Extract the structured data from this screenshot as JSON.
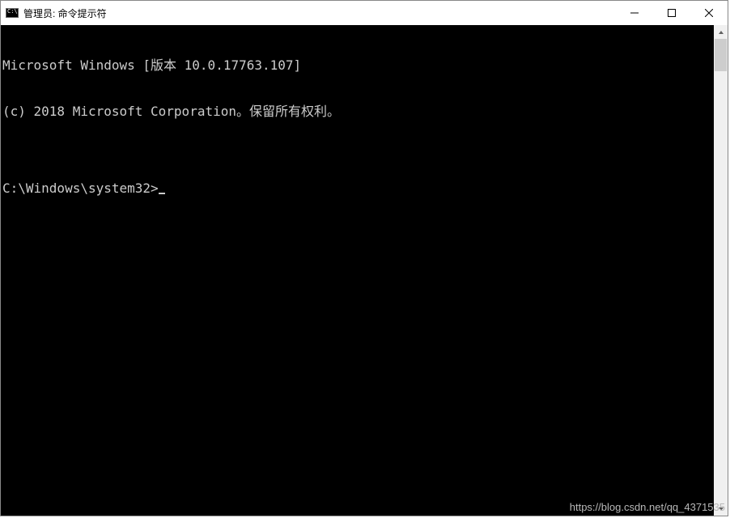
{
  "titlebar": {
    "title": "管理员: 命令提示符",
    "icon_label": "C:\\"
  },
  "terminal": {
    "line1": "Microsoft Windows [版本 10.0.17763.107]",
    "line2": "(c) 2018 Microsoft Corporation。保留所有权利。",
    "blank": "",
    "prompt": "C:\\Windows\\system32>"
  },
  "watermark": "https://blog.csdn.net/qq_4371535"
}
